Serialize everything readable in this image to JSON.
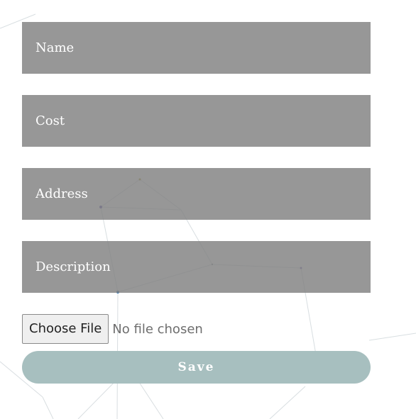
{
  "form": {
    "fields": [
      {
        "placeholder": "Name"
      },
      {
        "placeholder": "Cost"
      },
      {
        "placeholder": "Address"
      },
      {
        "placeholder": "Description"
      }
    ],
    "file_input": {
      "button_label": "Choose File",
      "status_text": "No file chosen"
    },
    "save_label": "Save"
  },
  "colors": {
    "field_background": "#8f8f8f",
    "field_text": "#ffffff",
    "save_button": "#a7bfbf",
    "save_text": "#ffffff"
  }
}
